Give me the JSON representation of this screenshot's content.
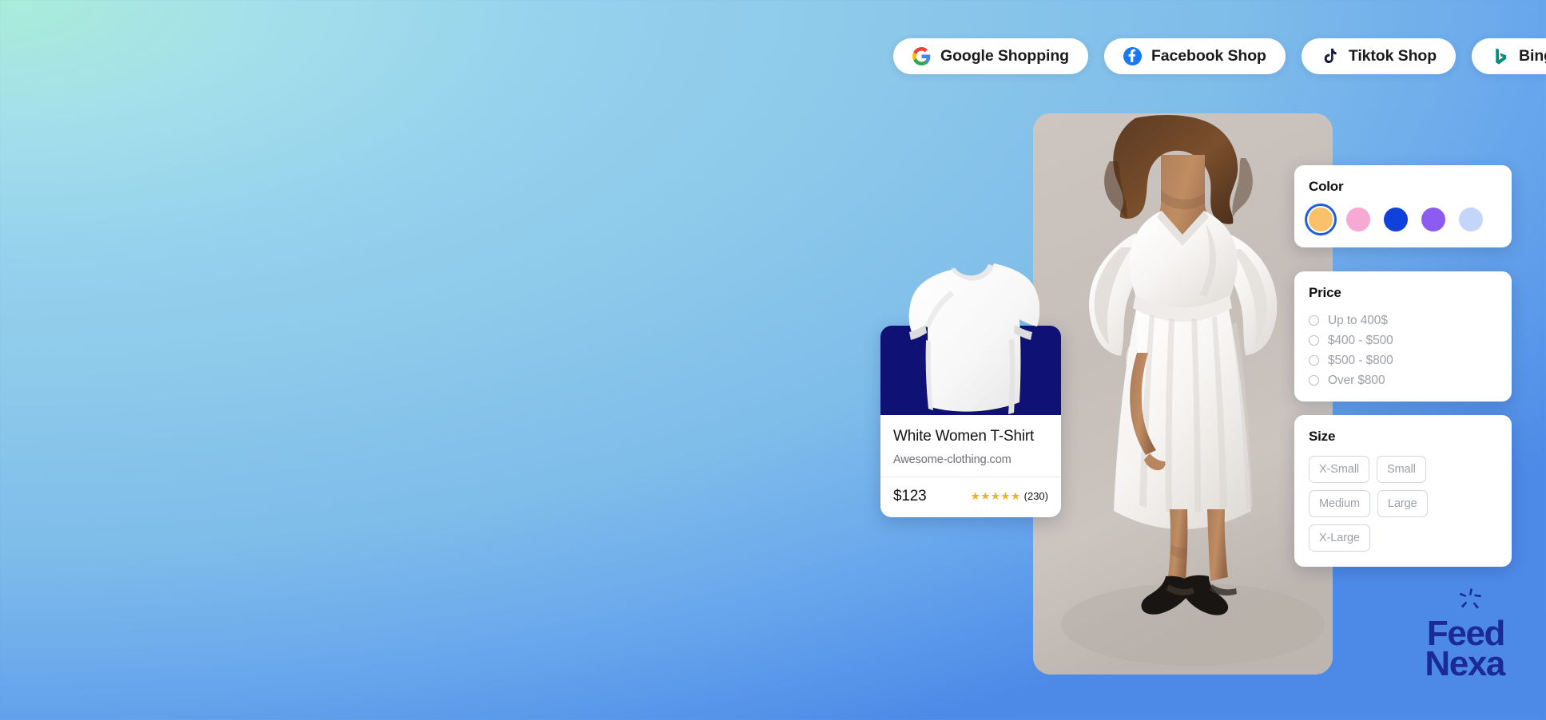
{
  "platform_pills": [
    {
      "label": "Google Shopping",
      "icon": "google-icon"
    },
    {
      "label": "Facebook Shop",
      "icon": "facebook-icon"
    },
    {
      "label": "Tiktok Shop",
      "icon": "tiktok-icon"
    },
    {
      "label": "Bing shopping",
      "icon": "bing-icon"
    }
  ],
  "product_card": {
    "title": "White Women T-Shirt",
    "domain": "Awesome-clothing.com",
    "price": "$123",
    "stars": "★★★★★",
    "review_count": "(230)",
    "image_bg_color": "#0f1175",
    "star_color": "#f2b01e"
  },
  "filters": {
    "color": {
      "title": "Color",
      "swatches": [
        {
          "name": "orange",
          "hex": "#fbc16a",
          "selected": true
        },
        {
          "name": "pink",
          "hex": "#f5a9d3",
          "selected": false
        },
        {
          "name": "blue",
          "hex": "#1141db",
          "selected": false
        },
        {
          "name": "purple",
          "hex": "#8c5cf0",
          "selected": false
        },
        {
          "name": "light-blue",
          "hex": "#c3d5f8",
          "selected": false
        }
      ],
      "selected_ring_color": "#1d5fe0"
    },
    "price": {
      "title": "Price",
      "options": [
        {
          "label": "Up to 400$",
          "selected": false
        },
        {
          "label": "$400 - $500",
          "selected": false
        },
        {
          "label": "$500 - $800",
          "selected": false
        },
        {
          "label": "Over $800",
          "selected": false
        }
      ]
    },
    "size": {
      "title": "Size",
      "options": [
        {
          "label": "X-Small",
          "selected": false
        },
        {
          "label": "Small",
          "selected": false
        },
        {
          "label": "Medium",
          "selected": false
        },
        {
          "label": "Large",
          "selected": false
        },
        {
          "label": "X-Large",
          "selected": false
        }
      ]
    }
  },
  "brand": {
    "line1": "Feed",
    "line2": "Nexa",
    "color": "#1b2a96"
  },
  "background": {
    "corner_mint": "#a9edd8",
    "mid_sky": "#8cc8ea",
    "corner_blue": "#4d8ae8"
  }
}
